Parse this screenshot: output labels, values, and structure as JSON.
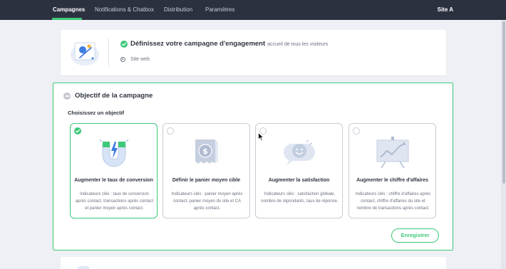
{
  "nav": {
    "items": [
      "Campagnes",
      "Notifications & Chatbox",
      "Distribution",
      "Paramètres"
    ],
    "active": "Campagnes",
    "site": "Site A"
  },
  "engagement": {
    "title": "Définissez votre campagne d'engagement",
    "subtitle": "accueil de tous les visiteurs",
    "channel": "Site web",
    "status_icon": "check-circle-icon",
    "channel_icon": "radio-dot-icon"
  },
  "objective": {
    "title": "Objectif de la campagne",
    "choose_label": "Choisissez un objectif",
    "options": [
      {
        "title": "Augmenter le taux de conversion",
        "description": "Indicateurs clés : taux de conversion après contact, transactions après contact et panier moyen après contact.",
        "selected": true,
        "icon": "magnet-icon"
      },
      {
        "title": "Définir le panier moyen cible",
        "description": "Indicateurs clés : panier moyen après contact, panier moyen du site et CA après contact.",
        "selected": false,
        "icon": "receipt-dollar-icon"
      },
      {
        "title": "Augmenter la satisfaction",
        "description": "Indicateurs clés : satisfaction globale, nombre de répondants, taux de réponse.",
        "selected": false,
        "icon": "smiley-chat-icon"
      },
      {
        "title": "Augmenter le chiffre d'affaires",
        "description": "Indicateurs clés : chiffre d'affaires après contact, chiffre d'affaires du site et nombre de transactions après contact.",
        "selected": false,
        "icon": "presentation-chart-icon"
      }
    ],
    "save_label": "Enregistrer"
  },
  "colors": {
    "accent": "#3ec879",
    "nav_bg": "#2c3140",
    "page_bg": "#eef0f5"
  }
}
